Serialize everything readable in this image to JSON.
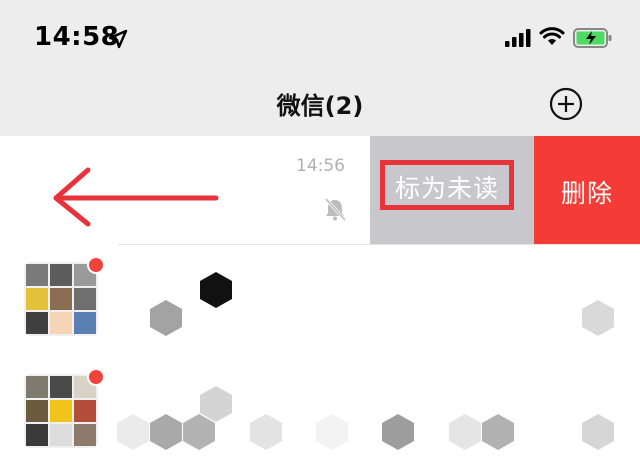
{
  "status_bar": {
    "time": "14:58",
    "icons": [
      "location-arrow-icon",
      "cellular-signal-icon",
      "wifi-icon",
      "battery-charging-icon"
    ]
  },
  "nav": {
    "title": "微信(2)",
    "add_icon": "plus-circle-icon"
  },
  "chat_rows": [
    {
      "time": "14:56",
      "muted": true,
      "swipe_actions": [
        {
          "label": "标为未读",
          "color": "#c7c7cc",
          "highlighted": true
        },
        {
          "label": "删除",
          "color": "#f23c35"
        }
      ],
      "gesture": "left-arrow-icon"
    },
    {
      "avatar": "group-avatar",
      "unread": true
    },
    {
      "avatar": "group-avatar",
      "unread": true
    }
  ],
  "colors": {
    "highlight_border": "#e8323c",
    "delete_bg": "#f23c35",
    "unread_action_bg": "#c7c7cc",
    "arrow": "#e8323c"
  }
}
